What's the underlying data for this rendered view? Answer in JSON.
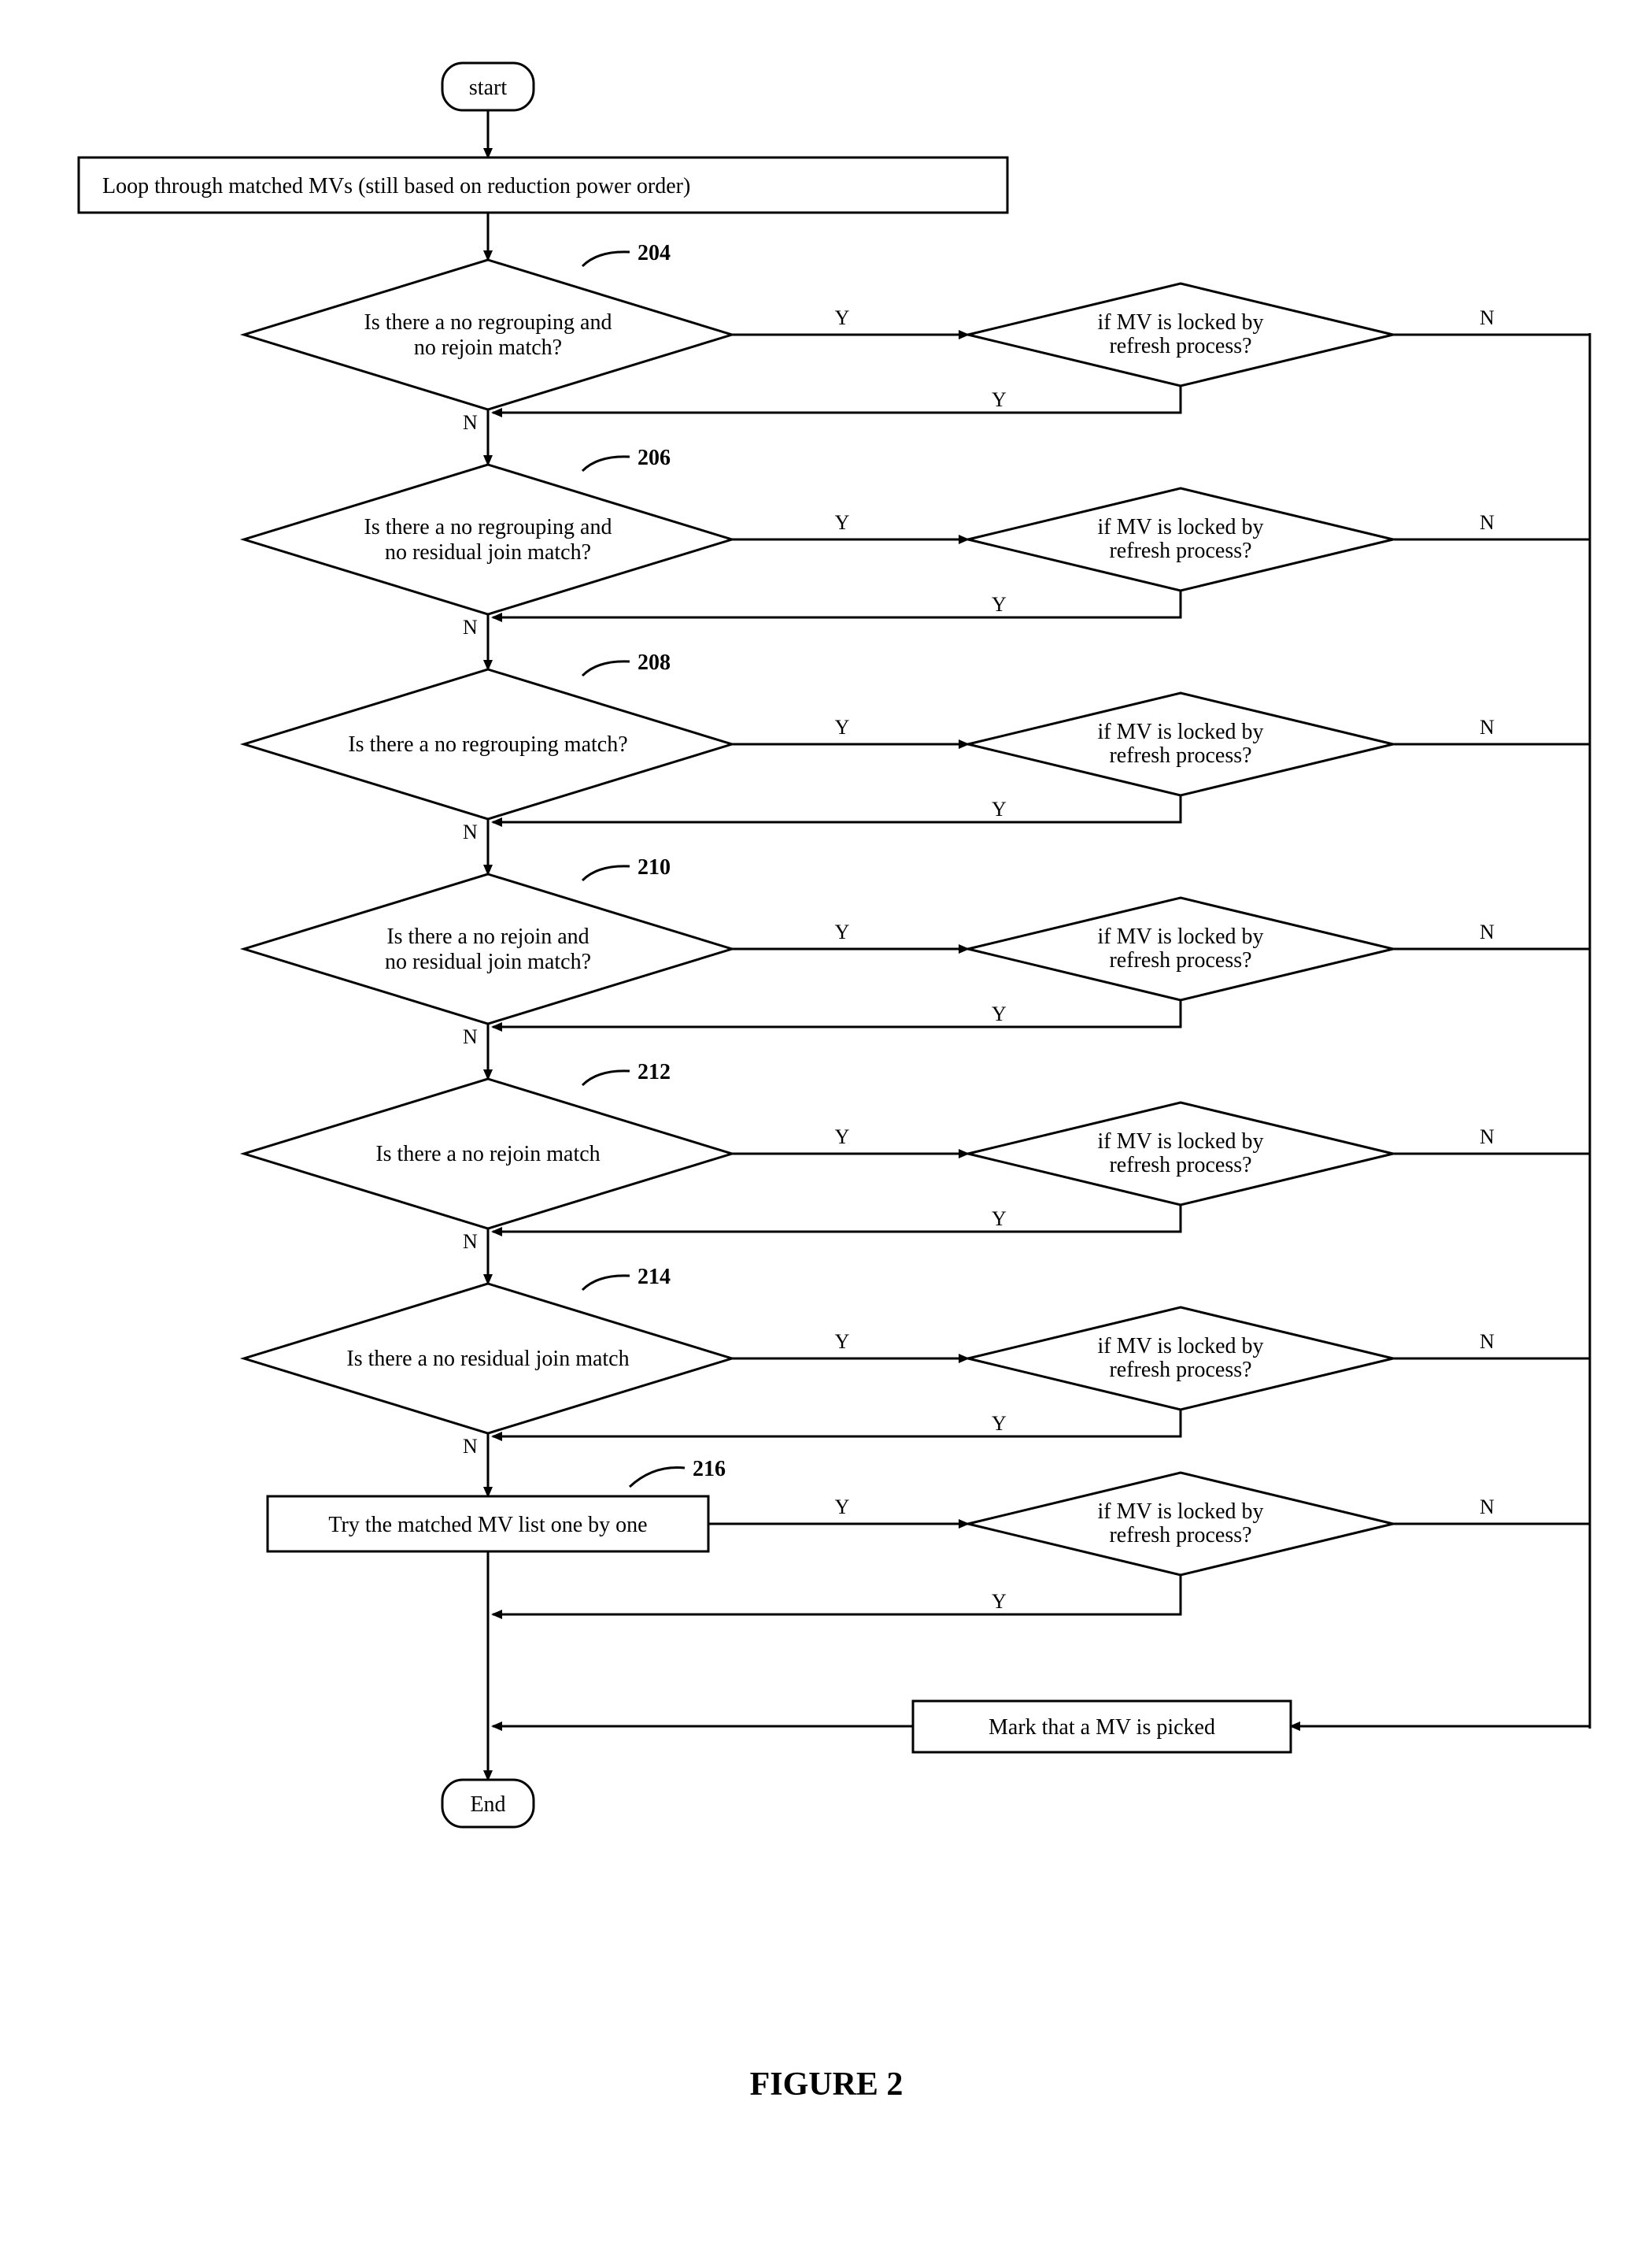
{
  "start": "start",
  "loop_box": "Loop through matched MVs  (still based on reduction power order)",
  "decisions": [
    {
      "ref": "204",
      "text1": "Is there a no regrouping and",
      "text2": "no rejoin match?"
    },
    {
      "ref": "206",
      "text1": "Is there a no regrouping and",
      "text2": "no residual join match?"
    },
    {
      "ref": "208",
      "text1": "Is there a no regrouping match?",
      "text2": ""
    },
    {
      "ref": "210",
      "text1": "Is there a no rejoin and",
      "text2": "no residual join match?"
    },
    {
      "ref": "212",
      "text1": "Is there a no rejoin match",
      "text2": ""
    },
    {
      "ref": "214",
      "text1": "Is there a no residual join match",
      "text2": ""
    }
  ],
  "lock_check": {
    "line1": "if MV is locked by",
    "line2": "refresh process?"
  },
  "try_box": "Try the matched MV list one by one",
  "try_ref": "216",
  "mark_box": "Mark that a MV is picked",
  "end": "End",
  "yes": "Y",
  "no": "N",
  "figure_title": "FIGURE 2"
}
